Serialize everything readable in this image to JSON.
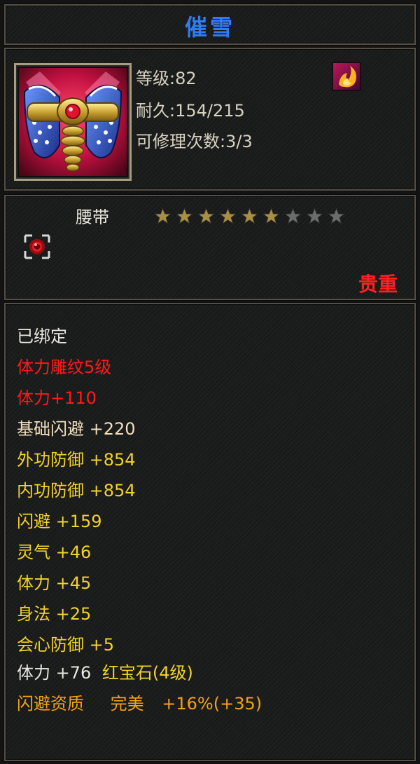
{
  "item": {
    "name": "催雪",
    "level_text": "等级:82",
    "durability_text": "耐久:154/215",
    "repair_text": "可修理次数:3/3",
    "type": "腰带",
    "stars_filled": 6,
    "stars_total": 9,
    "rarity": "贵重"
  },
  "stats": [
    {
      "text": "已绑定",
      "color": "white"
    },
    {
      "text": "体力雕纹5级",
      "color": "red"
    },
    {
      "text": "体力+110",
      "color": "red"
    },
    {
      "text": "基础闪避 +220",
      "color": "beige"
    },
    {
      "text": "外功防御 +854",
      "color": "yellow"
    },
    {
      "text": "内功防御 +854",
      "color": "yellow"
    },
    {
      "text": "闪避 +159",
      "color": "yellow"
    },
    {
      "text": "灵气 +46",
      "color": "yellow"
    },
    {
      "text": "体力 +45",
      "color": "yellow"
    },
    {
      "text": "身法 +25",
      "color": "yellow"
    },
    {
      "text": "会心防御 +5",
      "color": "yellow"
    }
  ],
  "gem_line": {
    "stat": "体力 +76",
    "gem": "红宝石(4级)"
  },
  "quality_line": {
    "label": "闪避资质",
    "grade": "完美",
    "bonus": "+16%(+35)"
  },
  "colors": {
    "title": "#2f7cf4",
    "rarity": "#ff2020",
    "star_filled": "#a98f3f",
    "star_empty": "#6c6c6c",
    "white": "#e8e8e0",
    "red": "#ff1a1a",
    "beige": "#f3dfbd",
    "yellow": "#f2d22a",
    "orange": "#f6a018"
  },
  "icons": {
    "item": "belt-item-icon",
    "rune": "flame-rune-icon",
    "socket": "gem-socket-icon",
    "star": "star-icon"
  }
}
